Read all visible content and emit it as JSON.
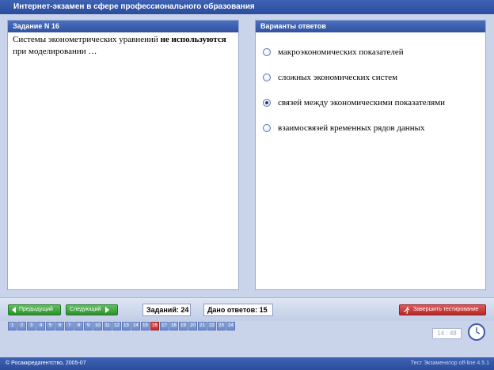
{
  "window": {
    "title": "Интернет-экзамен в сфере профессионального образования"
  },
  "question_panel": {
    "header": "Задание N 16",
    "text_part1": "Системы эконометрических уравнений ",
    "text_bold": "не используются",
    "text_part2": " при моделировании …"
  },
  "answers_panel": {
    "header": "Варианты ответов",
    "options": [
      {
        "label": "макроэкономических показателей",
        "selected": false
      },
      {
        "label": "сложных экономических систем",
        "selected": false
      },
      {
        "label": "связей между экономическими показателями",
        "selected": true
      },
      {
        "label": "взаимосвязей временных рядов данных",
        "selected": false
      }
    ]
  },
  "navigation": {
    "prev_label": "Предыдущий",
    "next_label": "Следующий",
    "tasks_count_label": "Заданий: 24",
    "answers_given_label": "Дано ответов: 15",
    "finish_label": "Завершить тестирование",
    "question_numbers": [
      "1",
      "2",
      "3",
      "4",
      "5",
      "6",
      "7",
      "8",
      "9",
      "10",
      "11",
      "12",
      "13",
      "14",
      "15",
      "16",
      "17",
      "18",
      "19",
      "20",
      "21",
      "22",
      "23",
      "24"
    ],
    "current_question": "16",
    "timer": "14 : 48"
  },
  "statusbar": {
    "left": "© Росаккредагентство, 2005-07",
    "right": "Тест Экзаменатор off-line 4.5.1"
  },
  "colors": {
    "background": "#c9d3ea",
    "header_blue": "#31529f",
    "button_green": "#2f8f2f",
    "button_red": "#b42828",
    "current_question": "#c23030"
  },
  "icons": {
    "prev": "triangle-left-icon",
    "next": "triangle-right-icon",
    "finish": "runner-icon",
    "clock": "clock-icon"
  }
}
